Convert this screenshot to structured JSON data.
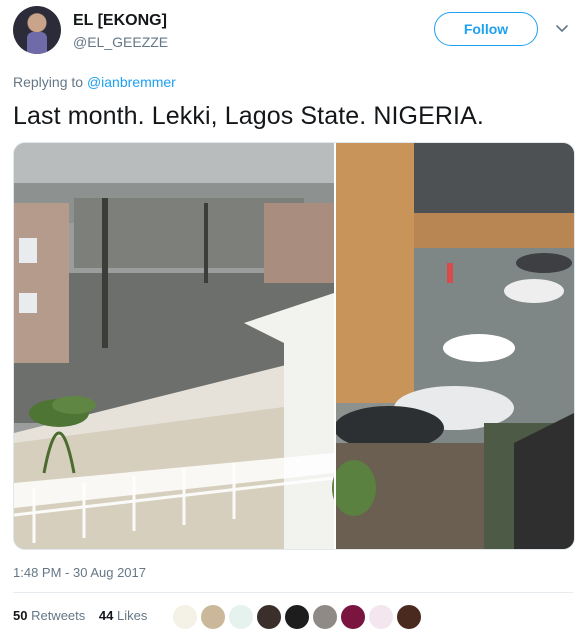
{
  "user": {
    "name": "EL [EKONG]",
    "handle": "@EL_GEEZZE"
  },
  "header": {
    "follow_label": "Follow"
  },
  "tweet": {
    "replying_prefix": "Replying to ",
    "replying_mention": "@ianbremmer",
    "text": "Last month. Lekki, Lagos State. NIGERIA.",
    "timestamp": "1:48 PM - 30 Aug 2017"
  },
  "stats": {
    "retweets_count": "50",
    "retweets_label": " Retweets",
    "likes_count": "44",
    "likes_label": " Likes"
  },
  "icons": {
    "chevron": "chevron-down-icon"
  },
  "colors": {
    "accent": "#1da1f2",
    "secondary_text": "#657786",
    "primary_text": "#14171a"
  }
}
